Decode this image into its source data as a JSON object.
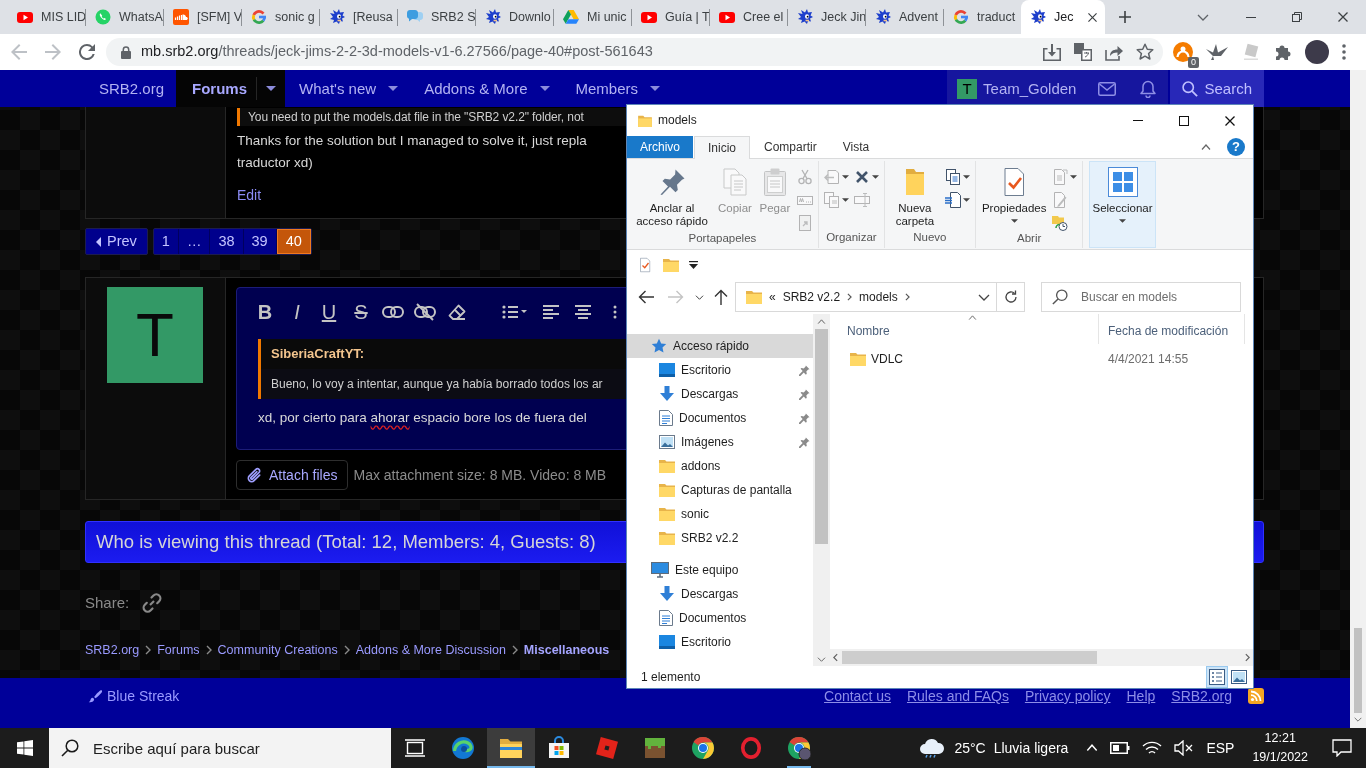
{
  "browser": {
    "tabs": [
      {
        "title": "MIS LID",
        "kind": "play",
        "selected": false
      },
      {
        "title": "WhatsA",
        "kind": "phone-chat",
        "selected": false
      },
      {
        "title": "[SFM] V",
        "kind": "cloud-audio",
        "selected": false
      },
      {
        "title": "sonic g",
        "kind": "letter-g",
        "selected": false
      },
      {
        "title": "[Reusa",
        "kind": "mascot",
        "selected": false
      },
      {
        "title": "SRB2 S",
        "kind": "speech",
        "selected": false
      },
      {
        "title": "Downlo",
        "kind": "mascot",
        "selected": false
      },
      {
        "title": "Mi unic",
        "kind": "triangle",
        "selected": false
      },
      {
        "title": "Guía | T",
        "kind": "play",
        "selected": false
      },
      {
        "title": "Cree el",
        "kind": "play",
        "selected": false
      },
      {
        "title": "Jeck Jin",
        "kind": "mascot",
        "selected": false
      },
      {
        "title": "Advent",
        "kind": "mascot",
        "selected": false
      },
      {
        "title": "traduct",
        "kind": "letter-g",
        "selected": false
      },
      {
        "title": "Jec",
        "kind": "mascot",
        "selected": true
      }
    ],
    "nav_buttons": [
      {
        "kind": "back",
        "disabled": true
      },
      {
        "kind": "forward",
        "disabled": true
      },
      {
        "kind": "reload",
        "disabled": false
      }
    ],
    "url": {
      "host": "mb.srb2.org",
      "path": "/threads/jeck-jims-2-2-3d-models-v1-6.27566/page-40#post-561643"
    },
    "extension_badge": "0"
  },
  "forum": {
    "nav": {
      "items": [
        {
          "label": "SRB2.org",
          "selected": false,
          "dropdown": false
        },
        {
          "label": "Forums",
          "selected": true,
          "dropdown": true
        },
        {
          "label": "What's new",
          "selected": false,
          "dropdown": true
        },
        {
          "label": "Addons & More",
          "selected": false,
          "dropdown": true
        },
        {
          "label": "Members",
          "selected": false,
          "dropdown": true
        }
      ],
      "user": {
        "avatar_letter": "T",
        "name": "Team_Golden"
      },
      "search": "Search"
    },
    "post": {
      "quote": "You need to put the models.dat file in the \"SRB2 v2.2\" folder, not",
      "text_lines": [
        "Thanks for the solution but I managed to solve it, just repla",
        "traductor xd)"
      ],
      "action": "Edit"
    },
    "pagination": {
      "prev": "Prev",
      "pages": [
        {
          "label": "1",
          "selected": false
        },
        {
          "label": "…",
          "selected": false
        },
        {
          "label": "38",
          "selected": false
        },
        {
          "label": "39",
          "selected": false
        },
        {
          "label": "40",
          "selected": true
        }
      ]
    },
    "reply": {
      "avatar_letter": "T",
      "toolbar": [
        {
          "kind": "bold",
          "label": "B"
        },
        {
          "kind": "italic",
          "label": "I"
        },
        {
          "kind": "underline",
          "label": "U"
        },
        {
          "kind": "strike",
          "label": "S"
        },
        {
          "kind": "link"
        },
        {
          "kind": "unlink"
        },
        {
          "kind": "eraser"
        },
        {
          "kind": "list"
        },
        {
          "kind": "align-left"
        },
        {
          "kind": "align-center"
        },
        {
          "kind": "more"
        }
      ],
      "quote": {
        "author": "SiberiaCraftYT:",
        "text": "Bueno, lo voy a intentar, aunque ya había borrado todos los ar"
      },
      "text": [
        {
          "text": "xd, por cierto para ",
          "misspelled": false
        },
        {
          "text": "ahorar",
          "misspelled": true
        },
        {
          "text": " espacio bore los de fuera del",
          "misspelled": false
        }
      ],
      "attach_button": "Attach files",
      "attach_hint": "Max attachment size: 8 MB. Video: 8 MB"
    },
    "viewers": "Who is viewing this thread (Total: 12, Members: 4, Guests: 8)",
    "share_label": "Share:",
    "breadcrumb": [
      {
        "label": "SRB2.org",
        "current": false
      },
      {
        "label": "Forums",
        "current": false
      },
      {
        "label": "Community Creations",
        "current": false
      },
      {
        "label": "Addons & More Discussion",
        "current": false
      },
      {
        "label": "Miscellaneous",
        "current": true
      }
    ],
    "footer": {
      "style_chooser": "Blue Streak",
      "links": [
        "Contact us",
        "Rules and FAQs",
        "Privacy policy",
        "Help",
        "SRB2.org"
      ]
    }
  },
  "explorer": {
    "title": "models",
    "ribbon_tabs": [
      {
        "label": "Archivo",
        "kind": "file-menu",
        "selected": false
      },
      {
        "label": "Inicio",
        "kind": "tab",
        "selected": true
      },
      {
        "label": "Compartir",
        "kind": "tab",
        "selected": false
      },
      {
        "label": "Vista",
        "kind": "tab",
        "selected": false
      }
    ],
    "help_label": "?",
    "ribbon_groups": [
      {
        "label": "Portapapeles",
        "large": [
          {
            "label": "Anclar al acceso rápido",
            "disabled": false,
            "dropdown": false,
            "highlighted": false
          },
          {
            "label": "Copiar",
            "disabled": true,
            "dropdown": false,
            "highlighted": false
          },
          {
            "label": "Pegar",
            "disabled": true,
            "dropdown": false,
            "highlighted": false
          }
        ],
        "small": [
          {
            "disabled": true,
            "dropdown": false
          },
          {
            "disabled": true,
            "dropdown": false
          },
          {
            "disabled": true,
            "dropdown": false
          }
        ]
      },
      {
        "label": "Organizar",
        "small": [
          {
            "disabled": true,
            "dropdown": true
          },
          {
            "disabled": true,
            "dropdown": true
          },
          {
            "disabled": false,
            "dropdown": true
          },
          {
            "disabled": true,
            "dropdown": false
          }
        ]
      },
      {
        "label": "Nuevo",
        "large": [
          {
            "label": "Nueva carpeta",
            "disabled": false,
            "dropdown": false,
            "highlighted": false
          }
        ],
        "small": [
          {
            "disabled": false,
            "dropdown": true
          },
          {
            "disabled": false,
            "dropdown": true
          }
        ]
      },
      {
        "label": "Abrir",
        "large": [
          {
            "label": "Propiedades",
            "disabled": false,
            "dropdown": true,
            "highlighted": false
          }
        ],
        "small": [
          {
            "disabled": true,
            "dropdown": true
          },
          {
            "disabled": true,
            "dropdown": false
          },
          {
            "disabled": false,
            "dropdown": false
          }
        ]
      },
      {
        "large": [
          {
            "label": "Seleccionar",
            "disabled": false,
            "dropdown": true,
            "highlighted": true
          }
        ]
      }
    ],
    "nav_buttons": [
      {
        "kind": "back",
        "disabled": false
      },
      {
        "kind": "forward",
        "disabled": true
      },
      {
        "kind": "recent",
        "disabled": false
      },
      {
        "kind": "up",
        "disabled": false
      }
    ],
    "path_overflow": "«",
    "path": [
      "SRB2 v2.2",
      "models"
    ],
    "search_placeholder": "Buscar en models",
    "tree": [
      {
        "label": "Acceso rápido",
        "kind": "star",
        "selected": true,
        "pinned": false,
        "children": [
          {
            "label": "Escritorio",
            "kind": "desktop",
            "selected": false,
            "pinned": true
          },
          {
            "label": "Descargas",
            "kind": "downloads",
            "selected": false,
            "pinned": true
          },
          {
            "label": "Documentos",
            "kind": "documents",
            "selected": false,
            "pinned": true
          },
          {
            "label": "Imágenes",
            "kind": "pictures",
            "selected": false,
            "pinned": true
          },
          {
            "label": "addons",
            "kind": "folder",
            "selected": false,
            "pinned": false
          },
          {
            "label": "Capturas de pantalla",
            "kind": "folder",
            "selected": false,
            "pinned": false
          },
          {
            "label": "sonic",
            "kind": "folder",
            "selected": false,
            "pinned": false
          },
          {
            "label": "SRB2 v2.2",
            "kind": "folder",
            "selected": false,
            "pinned": false
          }
        ]
      },
      {
        "label": "Este equipo",
        "kind": "computer",
        "selected": false,
        "pinned": false,
        "children": [
          {
            "label": "Descargas",
            "kind": "downloads",
            "selected": false,
            "pinned": false
          },
          {
            "label": "Documentos",
            "kind": "documents",
            "selected": false,
            "pinned": false
          },
          {
            "label": "Escritorio",
            "kind": "desktop",
            "selected": false,
            "pinned": false
          }
        ]
      }
    ],
    "columns": [
      {
        "label": "Nombre",
        "sorted": true
      },
      {
        "label": "Fecha de modificación",
        "sorted": false
      }
    ],
    "rows": [
      {
        "name": "VDLC",
        "modified": "4/4/2021 14:55",
        "kind": "folder",
        "selected": false
      }
    ],
    "status": "1 elemento",
    "views": [
      {
        "kind": "details",
        "selected": true
      },
      {
        "kind": "large-icons",
        "selected": false
      }
    ]
  },
  "taskbar": {
    "search_placeholder": "Escribe aquí para buscar",
    "apps": [
      {
        "kind": "task-view",
        "running": false,
        "focused": false
      },
      {
        "kind": "swirl-browser",
        "running": false,
        "focused": false
      },
      {
        "kind": "file-explorer",
        "running": true,
        "focused": true
      },
      {
        "kind": "store",
        "running": false,
        "focused": false
      },
      {
        "kind": "red-block",
        "running": false,
        "focused": false
      },
      {
        "kind": "grass-block",
        "running": false,
        "focused": false
      },
      {
        "kind": "browser",
        "running": false,
        "focused": false
      },
      {
        "kind": "ring-browser",
        "running": false,
        "focused": false
      },
      {
        "kind": "browser-profile",
        "running": true,
        "focused": false
      }
    ],
    "weather": {
      "temperature": "25°C",
      "condition": "Lluvia ligera"
    },
    "language": "ESP",
    "time": "12:21",
    "date": "19/1/2022"
  }
}
